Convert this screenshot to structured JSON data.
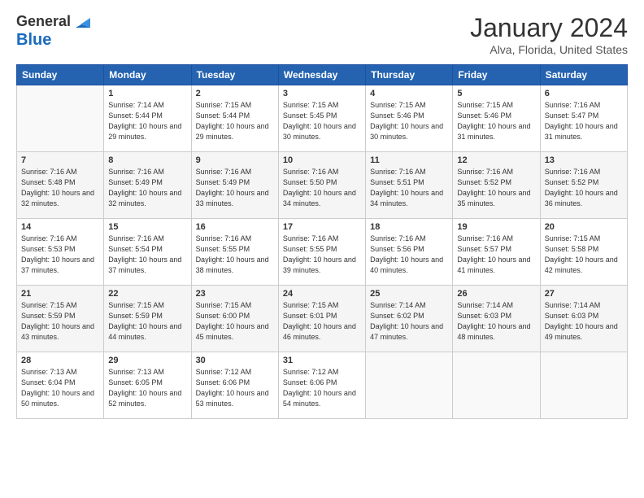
{
  "header": {
    "logo_line1": "General",
    "logo_line2": "Blue",
    "month": "January 2024",
    "location": "Alva, Florida, United States"
  },
  "weekdays": [
    "Sunday",
    "Monday",
    "Tuesday",
    "Wednesday",
    "Thursday",
    "Friday",
    "Saturday"
  ],
  "weeks": [
    [
      {
        "day": "",
        "sunrise": "",
        "sunset": "",
        "daylight": ""
      },
      {
        "day": "1",
        "sunrise": "7:14 AM",
        "sunset": "5:44 PM",
        "daylight": "10 hours and 29 minutes."
      },
      {
        "day": "2",
        "sunrise": "7:15 AM",
        "sunset": "5:44 PM",
        "daylight": "10 hours and 29 minutes."
      },
      {
        "day": "3",
        "sunrise": "7:15 AM",
        "sunset": "5:45 PM",
        "daylight": "10 hours and 30 minutes."
      },
      {
        "day": "4",
        "sunrise": "7:15 AM",
        "sunset": "5:46 PM",
        "daylight": "10 hours and 30 minutes."
      },
      {
        "day": "5",
        "sunrise": "7:15 AM",
        "sunset": "5:46 PM",
        "daylight": "10 hours and 31 minutes."
      },
      {
        "day": "6",
        "sunrise": "7:16 AM",
        "sunset": "5:47 PM",
        "daylight": "10 hours and 31 minutes."
      }
    ],
    [
      {
        "day": "7",
        "sunrise": "7:16 AM",
        "sunset": "5:48 PM",
        "daylight": "10 hours and 32 minutes."
      },
      {
        "day": "8",
        "sunrise": "7:16 AM",
        "sunset": "5:49 PM",
        "daylight": "10 hours and 32 minutes."
      },
      {
        "day": "9",
        "sunrise": "7:16 AM",
        "sunset": "5:49 PM",
        "daylight": "10 hours and 33 minutes."
      },
      {
        "day": "10",
        "sunrise": "7:16 AM",
        "sunset": "5:50 PM",
        "daylight": "10 hours and 34 minutes."
      },
      {
        "day": "11",
        "sunrise": "7:16 AM",
        "sunset": "5:51 PM",
        "daylight": "10 hours and 34 minutes."
      },
      {
        "day": "12",
        "sunrise": "7:16 AM",
        "sunset": "5:52 PM",
        "daylight": "10 hours and 35 minutes."
      },
      {
        "day": "13",
        "sunrise": "7:16 AM",
        "sunset": "5:52 PM",
        "daylight": "10 hours and 36 minutes."
      }
    ],
    [
      {
        "day": "14",
        "sunrise": "7:16 AM",
        "sunset": "5:53 PM",
        "daylight": "10 hours and 37 minutes."
      },
      {
        "day": "15",
        "sunrise": "7:16 AM",
        "sunset": "5:54 PM",
        "daylight": "10 hours and 37 minutes."
      },
      {
        "day": "16",
        "sunrise": "7:16 AM",
        "sunset": "5:55 PM",
        "daylight": "10 hours and 38 minutes."
      },
      {
        "day": "17",
        "sunrise": "7:16 AM",
        "sunset": "5:55 PM",
        "daylight": "10 hours and 39 minutes."
      },
      {
        "day": "18",
        "sunrise": "7:16 AM",
        "sunset": "5:56 PM",
        "daylight": "10 hours and 40 minutes."
      },
      {
        "day": "19",
        "sunrise": "7:16 AM",
        "sunset": "5:57 PM",
        "daylight": "10 hours and 41 minutes."
      },
      {
        "day": "20",
        "sunrise": "7:15 AM",
        "sunset": "5:58 PM",
        "daylight": "10 hours and 42 minutes."
      }
    ],
    [
      {
        "day": "21",
        "sunrise": "7:15 AM",
        "sunset": "5:59 PM",
        "daylight": "10 hours and 43 minutes."
      },
      {
        "day": "22",
        "sunrise": "7:15 AM",
        "sunset": "5:59 PM",
        "daylight": "10 hours and 44 minutes."
      },
      {
        "day": "23",
        "sunrise": "7:15 AM",
        "sunset": "6:00 PM",
        "daylight": "10 hours and 45 minutes."
      },
      {
        "day": "24",
        "sunrise": "7:15 AM",
        "sunset": "6:01 PM",
        "daylight": "10 hours and 46 minutes."
      },
      {
        "day": "25",
        "sunrise": "7:14 AM",
        "sunset": "6:02 PM",
        "daylight": "10 hours and 47 minutes."
      },
      {
        "day": "26",
        "sunrise": "7:14 AM",
        "sunset": "6:03 PM",
        "daylight": "10 hours and 48 minutes."
      },
      {
        "day": "27",
        "sunrise": "7:14 AM",
        "sunset": "6:03 PM",
        "daylight": "10 hours and 49 minutes."
      }
    ],
    [
      {
        "day": "28",
        "sunrise": "7:13 AM",
        "sunset": "6:04 PM",
        "daylight": "10 hours and 50 minutes."
      },
      {
        "day": "29",
        "sunrise": "7:13 AM",
        "sunset": "6:05 PM",
        "daylight": "10 hours and 52 minutes."
      },
      {
        "day": "30",
        "sunrise": "7:12 AM",
        "sunset": "6:06 PM",
        "daylight": "10 hours and 53 minutes."
      },
      {
        "day": "31",
        "sunrise": "7:12 AM",
        "sunset": "6:06 PM",
        "daylight": "10 hours and 54 minutes."
      },
      {
        "day": "",
        "sunrise": "",
        "sunset": "",
        "daylight": ""
      },
      {
        "day": "",
        "sunrise": "",
        "sunset": "",
        "daylight": ""
      },
      {
        "day": "",
        "sunrise": "",
        "sunset": "",
        "daylight": ""
      }
    ]
  ]
}
